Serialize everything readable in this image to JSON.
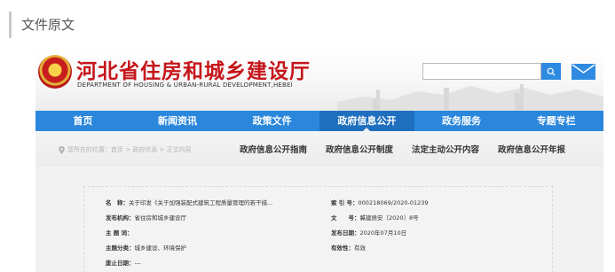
{
  "section": {
    "title": "文件原文"
  },
  "site": {
    "title": "河北省住房和城乡建设厅",
    "subtitle": "DEPARTMENT OF HOUSING & URBAN-RURAL DEVELOPMENT,HEBEI",
    "search": {
      "placeholder": ""
    }
  },
  "nav": {
    "items": [
      {
        "label": "首页"
      },
      {
        "label": "新闻资讯"
      },
      {
        "label": "政策文件"
      },
      {
        "label": "政府信息公开"
      },
      {
        "label": "政务服务"
      },
      {
        "label": "专题专栏"
      }
    ],
    "active_index": 3
  },
  "subnav": {
    "location": "您所在的位置：首页 > 政府信息 > 正文内容",
    "items": [
      {
        "label": "政府信息公开指南"
      },
      {
        "label": "政府信息公开制度"
      },
      {
        "label": "法定主动公开内容"
      },
      {
        "label": "政府信息公开年报"
      }
    ]
  },
  "info": {
    "left": [
      {
        "key": "名　称：",
        "value": "关于印发《关于加强装配式建筑工程质量管理的若干措..."
      },
      {
        "key": "发布机构：",
        "value": "省住房和城乡建设厅"
      },
      {
        "key": "主 题 词：",
        "value": ""
      },
      {
        "key": "主题分类：",
        "value": "城乡建设、环境保护"
      },
      {
        "key": "废止日期：",
        "value": "---"
      }
    ],
    "right": [
      {
        "key": "索 引 号：",
        "value": "000218069/2020-01239"
      },
      {
        "key": "文　　号：",
        "value": "冀建质安〔2020〕8号"
      },
      {
        "key": "发布日期：",
        "value": "2020年07月10日"
      },
      {
        "key": "有效性：",
        "value": "有效"
      }
    ]
  },
  "colors": {
    "brand_red": "#c5151b",
    "nav_blue": "#2a87db",
    "nav_active": "#1f6fbf",
    "search_blue": "#2f8be2"
  },
  "icons": {
    "search": "search-icon",
    "mail": "mail-icon",
    "emblem": "national-emblem-icon",
    "location": "location-pin-icon"
  }
}
